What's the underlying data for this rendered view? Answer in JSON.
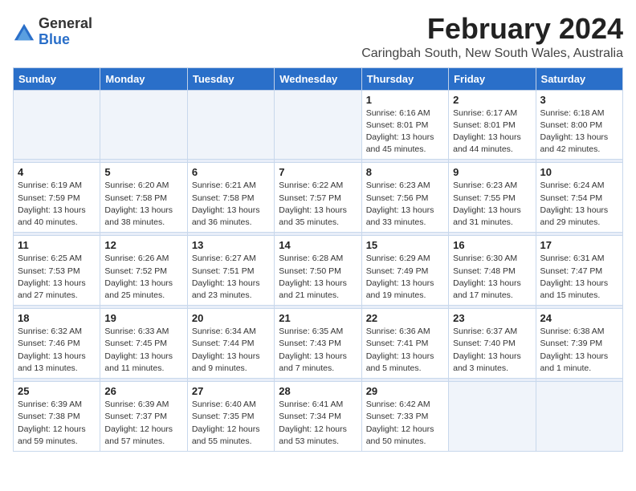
{
  "header": {
    "logo_general": "General",
    "logo_blue": "Blue",
    "month_title": "February 2024",
    "location": "Caringbah South, New South Wales, Australia"
  },
  "weekdays": [
    "Sunday",
    "Monday",
    "Tuesday",
    "Wednesday",
    "Thursday",
    "Friday",
    "Saturday"
  ],
  "weeks": [
    [
      {
        "day": "",
        "detail": ""
      },
      {
        "day": "",
        "detail": ""
      },
      {
        "day": "",
        "detail": ""
      },
      {
        "day": "",
        "detail": ""
      },
      {
        "day": "1",
        "detail": "Sunrise: 6:16 AM\nSunset: 8:01 PM\nDaylight: 13 hours\nand 45 minutes."
      },
      {
        "day": "2",
        "detail": "Sunrise: 6:17 AM\nSunset: 8:01 PM\nDaylight: 13 hours\nand 44 minutes."
      },
      {
        "day": "3",
        "detail": "Sunrise: 6:18 AM\nSunset: 8:00 PM\nDaylight: 13 hours\nand 42 minutes."
      }
    ],
    [
      {
        "day": "4",
        "detail": "Sunrise: 6:19 AM\nSunset: 7:59 PM\nDaylight: 13 hours\nand 40 minutes."
      },
      {
        "day": "5",
        "detail": "Sunrise: 6:20 AM\nSunset: 7:58 PM\nDaylight: 13 hours\nand 38 minutes."
      },
      {
        "day": "6",
        "detail": "Sunrise: 6:21 AM\nSunset: 7:58 PM\nDaylight: 13 hours\nand 36 minutes."
      },
      {
        "day": "7",
        "detail": "Sunrise: 6:22 AM\nSunset: 7:57 PM\nDaylight: 13 hours\nand 35 minutes."
      },
      {
        "day": "8",
        "detail": "Sunrise: 6:23 AM\nSunset: 7:56 PM\nDaylight: 13 hours\nand 33 minutes."
      },
      {
        "day": "9",
        "detail": "Sunrise: 6:23 AM\nSunset: 7:55 PM\nDaylight: 13 hours\nand 31 minutes."
      },
      {
        "day": "10",
        "detail": "Sunrise: 6:24 AM\nSunset: 7:54 PM\nDaylight: 13 hours\nand 29 minutes."
      }
    ],
    [
      {
        "day": "11",
        "detail": "Sunrise: 6:25 AM\nSunset: 7:53 PM\nDaylight: 13 hours\nand 27 minutes."
      },
      {
        "day": "12",
        "detail": "Sunrise: 6:26 AM\nSunset: 7:52 PM\nDaylight: 13 hours\nand 25 minutes."
      },
      {
        "day": "13",
        "detail": "Sunrise: 6:27 AM\nSunset: 7:51 PM\nDaylight: 13 hours\nand 23 minutes."
      },
      {
        "day": "14",
        "detail": "Sunrise: 6:28 AM\nSunset: 7:50 PM\nDaylight: 13 hours\nand 21 minutes."
      },
      {
        "day": "15",
        "detail": "Sunrise: 6:29 AM\nSunset: 7:49 PM\nDaylight: 13 hours\nand 19 minutes."
      },
      {
        "day": "16",
        "detail": "Sunrise: 6:30 AM\nSunset: 7:48 PM\nDaylight: 13 hours\nand 17 minutes."
      },
      {
        "day": "17",
        "detail": "Sunrise: 6:31 AM\nSunset: 7:47 PM\nDaylight: 13 hours\nand 15 minutes."
      }
    ],
    [
      {
        "day": "18",
        "detail": "Sunrise: 6:32 AM\nSunset: 7:46 PM\nDaylight: 13 hours\nand 13 minutes."
      },
      {
        "day": "19",
        "detail": "Sunrise: 6:33 AM\nSunset: 7:45 PM\nDaylight: 13 hours\nand 11 minutes."
      },
      {
        "day": "20",
        "detail": "Sunrise: 6:34 AM\nSunset: 7:44 PM\nDaylight: 13 hours\nand 9 minutes."
      },
      {
        "day": "21",
        "detail": "Sunrise: 6:35 AM\nSunset: 7:43 PM\nDaylight: 13 hours\nand 7 minutes."
      },
      {
        "day": "22",
        "detail": "Sunrise: 6:36 AM\nSunset: 7:41 PM\nDaylight: 13 hours\nand 5 minutes."
      },
      {
        "day": "23",
        "detail": "Sunrise: 6:37 AM\nSunset: 7:40 PM\nDaylight: 13 hours\nand 3 minutes."
      },
      {
        "day": "24",
        "detail": "Sunrise: 6:38 AM\nSunset: 7:39 PM\nDaylight: 13 hours\nand 1 minute."
      }
    ],
    [
      {
        "day": "25",
        "detail": "Sunrise: 6:39 AM\nSunset: 7:38 PM\nDaylight: 12 hours\nand 59 minutes."
      },
      {
        "day": "26",
        "detail": "Sunrise: 6:39 AM\nSunset: 7:37 PM\nDaylight: 12 hours\nand 57 minutes."
      },
      {
        "day": "27",
        "detail": "Sunrise: 6:40 AM\nSunset: 7:35 PM\nDaylight: 12 hours\nand 55 minutes."
      },
      {
        "day": "28",
        "detail": "Sunrise: 6:41 AM\nSunset: 7:34 PM\nDaylight: 12 hours\nand 53 minutes."
      },
      {
        "day": "29",
        "detail": "Sunrise: 6:42 AM\nSunset: 7:33 PM\nDaylight: 12 hours\nand 50 minutes."
      },
      {
        "day": "",
        "detail": ""
      },
      {
        "day": "",
        "detail": ""
      }
    ]
  ]
}
